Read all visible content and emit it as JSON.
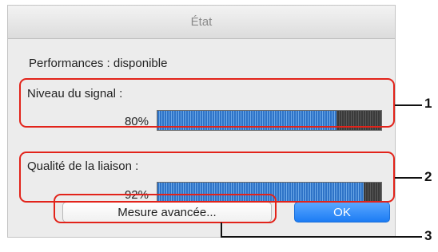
{
  "dialog": {
    "title": "État",
    "performance_text": "Performances : disponible",
    "signal": {
      "label": "Niveau du signal :",
      "percent_text": "80%",
      "level": 0.8
    },
    "link_quality": {
      "label": "Qualité de la liaison :",
      "percent_text": "92%",
      "level": 0.92
    },
    "advanced_button_label": "Mesure avancée...",
    "ok_button_label": "OK"
  },
  "callouts": [
    "1",
    "2",
    "3"
  ],
  "colors": {
    "highlight": "#e2231a",
    "bar_fill": "#2e73c7",
    "ok_button": "#1c7cf4"
  }
}
